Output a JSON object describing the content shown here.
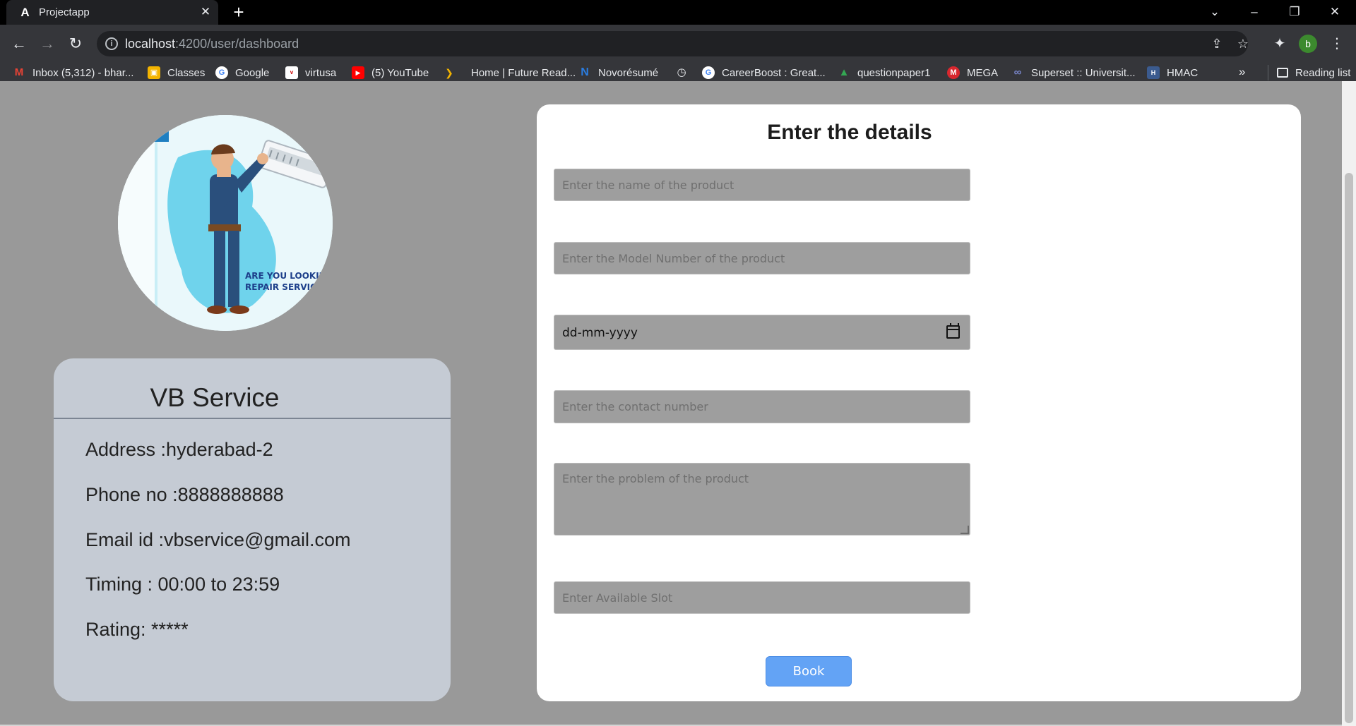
{
  "browser": {
    "tab_title": "Projectapp",
    "tab_favicon": "A",
    "url_host": "localhost",
    "url_path": ":4200/user/dashboard",
    "profile_initial": "b",
    "reading_list_label": "Reading list",
    "bookmarks": [
      {
        "label": "Inbox (5,312) - bhar...",
        "icon": "gmail-icon",
        "color": "#ea4335"
      },
      {
        "label": "Classes",
        "icon": "google-classroom-icon",
        "color": "#f4b400"
      },
      {
        "label": "Google",
        "icon": "google-icon",
        "color": "#ffffff"
      },
      {
        "label": "virtusa",
        "icon": "virtusa-icon",
        "color": "#ffffff"
      },
      {
        "label": "(5) YouTube",
        "icon": "youtube-icon",
        "color": "#ff0000"
      },
      {
        "label": "Home | Future Read...",
        "icon": "future-ready-icon",
        "color": "#f4b400"
      },
      {
        "label": "Novorésumé",
        "icon": "novoresume-icon",
        "color": "#2a7de1"
      },
      {
        "label": "",
        "icon": "history-icon",
        "color": "#e8eaed"
      },
      {
        "label": "CareerBoost : Great...",
        "icon": "google-icon",
        "color": "#ffffff"
      },
      {
        "label": "questionpaper1",
        "icon": "google-drive-icon",
        "color": "#34a853"
      },
      {
        "label": "MEGA",
        "icon": "mega-icon",
        "color": "#d9272e"
      },
      {
        "label": "Superset :: Universit...",
        "icon": "superset-icon",
        "color": "#5c6bc0"
      },
      {
        "label": "HMAC",
        "icon": "hmac-icon",
        "color": "#3b5b8f"
      }
    ]
  },
  "provider": {
    "name": "VB Service",
    "address": "Address :hyderabad-2",
    "phone": "Phone no :8888888888",
    "email": "Email id :vbservice@gmail.com",
    "timing": "Timing : 00:00 to 23:59",
    "rating": "Rating: *****",
    "image_caption_line1": "ARE YOU LOOKING A",
    "image_caption_line2": "REPAIR SERVICE"
  },
  "form": {
    "title": "Enter the details",
    "product_name_placeholder": "Enter the name of the product",
    "model_number_placeholder": "Enter the Model Number of the product",
    "date_placeholder": "dd-mm-yyyy",
    "contact_placeholder": "Enter the contact number",
    "problem_placeholder": "Enter the problem of the product",
    "slot_placeholder": "Enter Available Slot",
    "submit_label": "Book"
  }
}
